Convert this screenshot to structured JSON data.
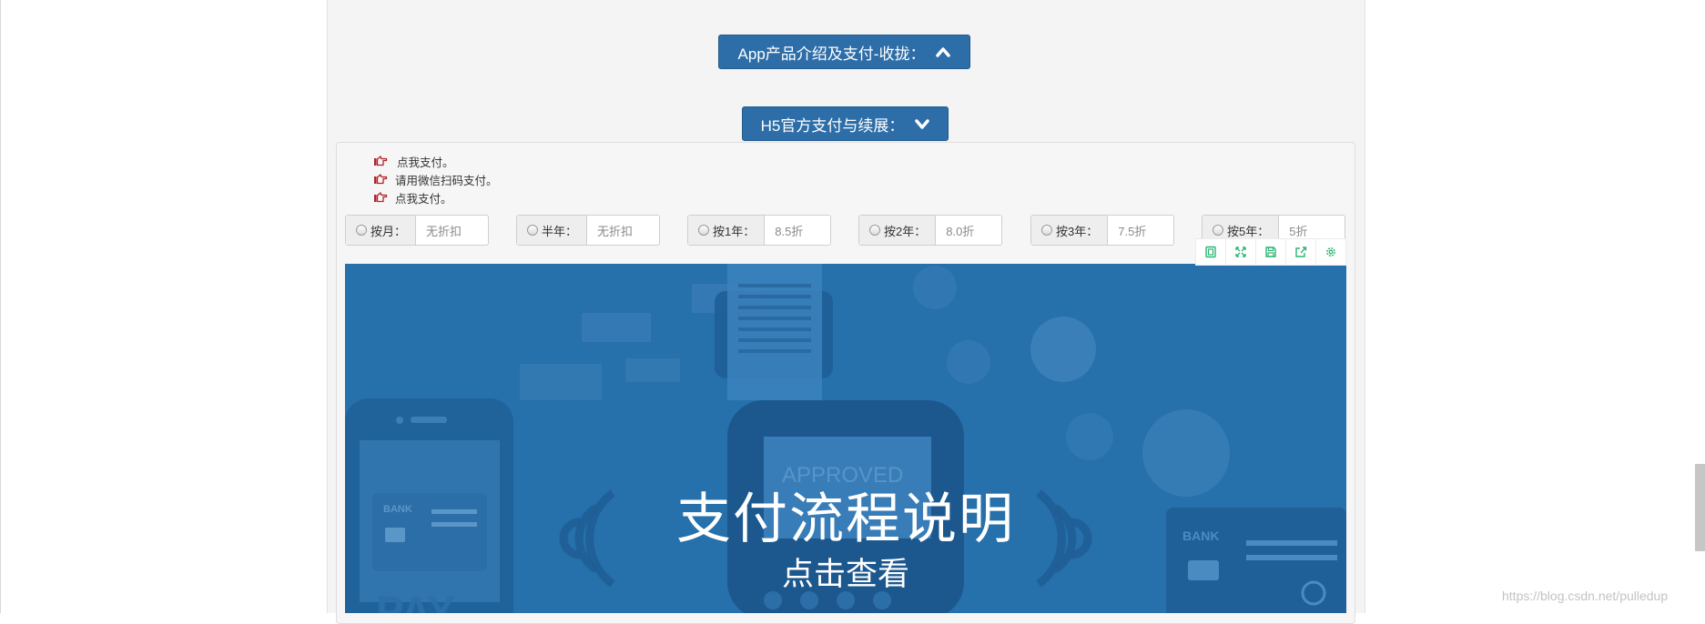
{
  "buttons": {
    "app_intro": "App产品介绍及支付-收拢：",
    "h5_pay": "H5官方支付与续展："
  },
  "tips": [
    "点我支付。",
    "请用微信扫码支付。",
    "点我支付。"
  ],
  "plans": [
    {
      "label": "按月：",
      "value": "无折扣"
    },
    {
      "label": "半年：",
      "value": "无折扣"
    },
    {
      "label": "按1年：",
      "value": "8.5折"
    },
    {
      "label": "按2年：",
      "value": "8.0折"
    },
    {
      "label": "按3年：",
      "value": "7.5折"
    },
    {
      "label": "按5年：",
      "value": "5折"
    }
  ],
  "banner": {
    "title": "支付流程说明",
    "subtitle": "点击查看",
    "screen_text": "APPROVED",
    "card_text": "BANK",
    "pay_text": "PAY"
  },
  "watermark": "https://blog.csdn.net/pulledup",
  "icons": {
    "toolbar": [
      "copy-icon",
      "fullscreen-icon",
      "save-icon",
      "share-icon",
      "settings-icon"
    ],
    "tip": "pointing-hand-icon",
    "toggle_up": "chevron-up-icon",
    "toggle_down": "chevron-down-icon"
  },
  "colors": {
    "button_bg": "#2e6ea8",
    "banner_bg": "#2670ab",
    "toolbar_icon": "#2bb673",
    "tip_icon": "#b3222b"
  }
}
